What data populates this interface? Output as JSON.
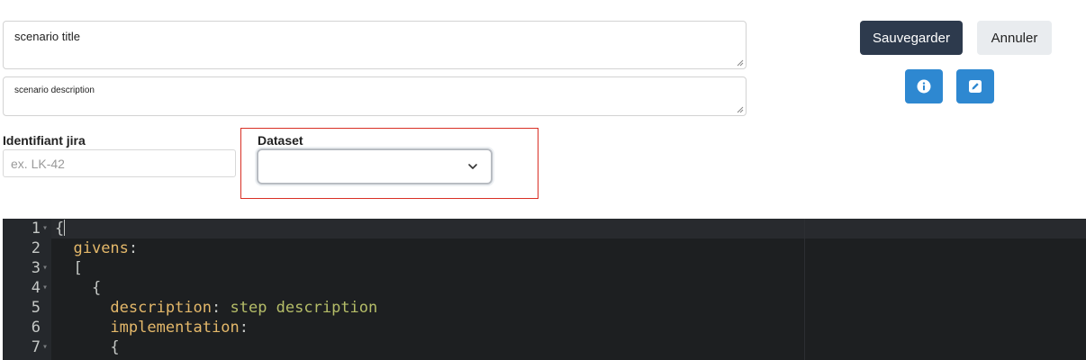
{
  "form": {
    "title_field": {
      "value": "scenario title"
    },
    "description_field": {
      "value": "scenario description"
    },
    "jira": {
      "label": "Identifiant jira",
      "placeholder": "ex. LK-42",
      "value": ""
    },
    "dataset": {
      "label": "Dataset",
      "selected": ""
    }
  },
  "toolbar": {
    "save_label": "Sauvegarder",
    "cancel_label": "Annuler",
    "info_icon": "info-icon",
    "edit_icon": "edit-icon"
  },
  "editor": {
    "lines": [
      {
        "num": "1",
        "fold": true,
        "key": "",
        "sep": "",
        "val": "",
        "text": "{",
        "indent": ""
      },
      {
        "num": "2",
        "fold": false,
        "key": "givens",
        "sep": ":",
        "val": "",
        "text": "",
        "indent": "  "
      },
      {
        "num": "3",
        "fold": true,
        "key": "",
        "sep": "",
        "val": "",
        "text": "[",
        "indent": "  "
      },
      {
        "num": "4",
        "fold": true,
        "key": "",
        "sep": "",
        "val": "",
        "text": "{",
        "indent": "    "
      },
      {
        "num": "5",
        "fold": false,
        "key": "description",
        "sep": ": ",
        "val": "step description",
        "text": "",
        "indent": "      "
      },
      {
        "num": "6",
        "fold": false,
        "key": "implementation",
        "sep": ":",
        "val": "",
        "text": "",
        "indent": "      "
      },
      {
        "num": "7",
        "fold": true,
        "key": "",
        "sep": "",
        "val": "",
        "text": "{",
        "indent": "      "
      }
    ]
  },
  "colors": {
    "save_button": "#2d3a4d",
    "icon_buttons": "#2e88d1",
    "dataset_highlight": "#d93025",
    "editor_bg": "#1d1f21",
    "code_key": "#e4b86a",
    "code_string": "#b5bd68"
  }
}
